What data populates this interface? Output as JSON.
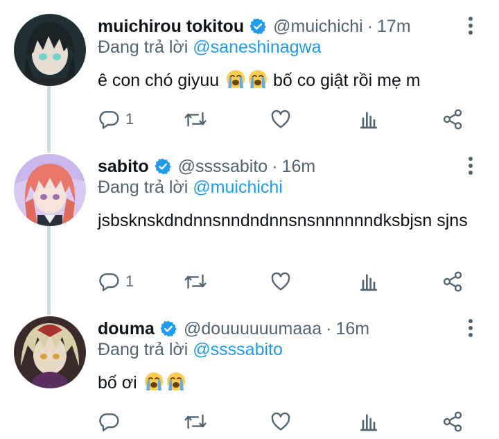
{
  "tweets": [
    {
      "name": "muichirou tokitou",
      "handle": "@muichichi",
      "separator": "·",
      "time": "17m",
      "replying_prefix": "Đang trả lời",
      "replying_to": "@saneshinagwa",
      "text": "ê con chó giyuu",
      "text_after": "bố co giật rồi mẹ m",
      "emojis": [
        "loudly-crying-face",
        "loudly-crying-face"
      ],
      "reply_count": "1",
      "avatar_colors": {
        "bg": "#1f2f33",
        "hair": "#1b2327",
        "skin": "#e7dcd2",
        "eye": "#6fd3c8"
      }
    },
    {
      "name": "sabito",
      "handle": "@ssssabito",
      "separator": "·",
      "time": "16m",
      "replying_prefix": "Đang trả lời",
      "replying_to": "@muichichi",
      "text": "jsbsknskdndnnsnndndnnsnsnnnnnndksbjsn sjns",
      "text_after": "",
      "emojis": [],
      "reply_count": "1",
      "avatar_colors": {
        "bg": "#d9c9f2",
        "hair": "#e8776a",
        "skin": "#f6e3dc",
        "eye": "#9a6fb0"
      }
    },
    {
      "name": "douma",
      "handle": "@douuuuuumaaa",
      "separator": "·",
      "time": "16m",
      "replying_prefix": "Đang trả lời",
      "replying_to": "@ssssabito",
      "text": "bố ơi",
      "text_after": "",
      "emojis": [
        "loudly-crying-face",
        "loudly-crying-face"
      ],
      "reply_count": "",
      "avatar_colors": {
        "bg": "#3b2a2a",
        "hair": "#d8cfa8",
        "skin": "#e8d9c4",
        "eye": "#d9a13a"
      }
    }
  ],
  "colors": {
    "verified": "#1d9bf0",
    "mention": "#1d9bf0",
    "secondary": "#536471",
    "thread_line": "#cfd9de"
  },
  "icons": {
    "reply": "reply-bubble-icon",
    "retweet": "retweet-icon",
    "like": "heart-icon",
    "views": "analytics-icon",
    "share": "share-icon",
    "more": "more-vertical-icon",
    "verified": "verified-badge-icon"
  }
}
